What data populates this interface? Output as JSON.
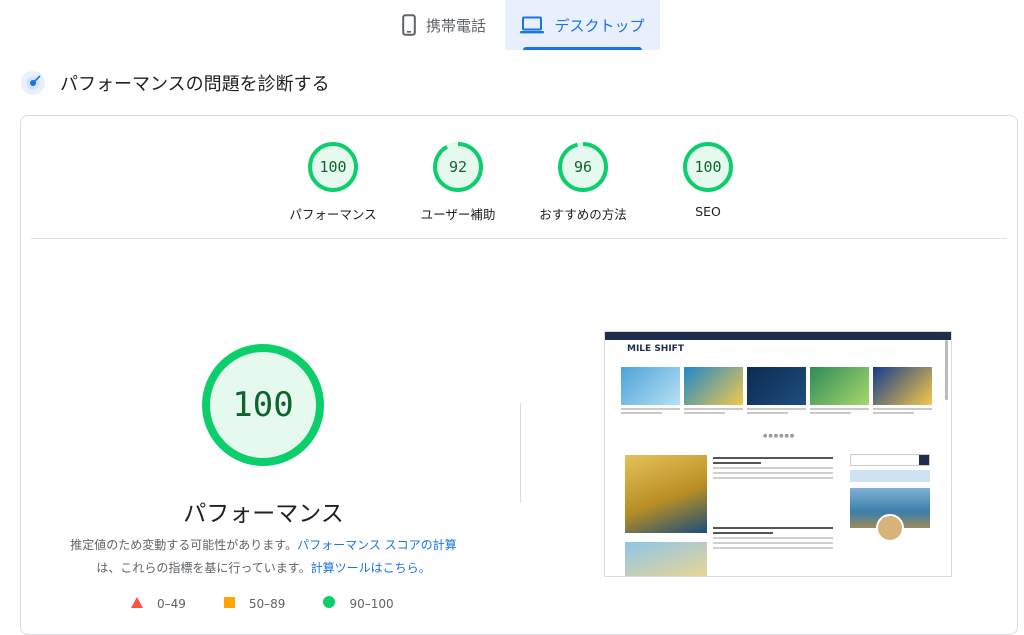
{
  "tabs": {
    "mobile": {
      "label": "携帯電話",
      "icon": "smartphone-icon"
    },
    "desktop": {
      "label": "デスクトップ",
      "icon": "laptop-icon",
      "selected": true
    }
  },
  "section": {
    "title": "パフォーマンスの問題を診断する",
    "icon": "diagnostics-icon"
  },
  "scores": [
    {
      "value": 100,
      "label": "パフォーマンス"
    },
    {
      "value": 92,
      "label": "ユーザー補助"
    },
    {
      "value": 96,
      "label": "おすすめの方法"
    },
    {
      "value": 100,
      "label": "SEO"
    }
  ],
  "main_score": {
    "value": 100,
    "title": "パフォーマンス"
  },
  "description": {
    "text1": "推定値のため変動する可能性があります。",
    "link1": "パフォーマンス スコアの計算",
    "text2": "は、これらの指標を基に行っています。",
    "link2": "計算ツールはこちら。"
  },
  "legend": [
    {
      "range": "0–49",
      "shape": "triangle",
      "color": "#ff4e42"
    },
    {
      "range": "50–89",
      "shape": "square",
      "color": "#ffa400"
    },
    {
      "range": "90–100",
      "shape": "circle",
      "color": "#0cce6b"
    }
  ],
  "screenshot": {
    "logo": "MILE SHIFT"
  },
  "colors": {
    "pass": "#0cce6b",
    "pass_fill": "#e6f9ee",
    "pass_text": "#0d652d",
    "accent": "#1a73e8"
  }
}
